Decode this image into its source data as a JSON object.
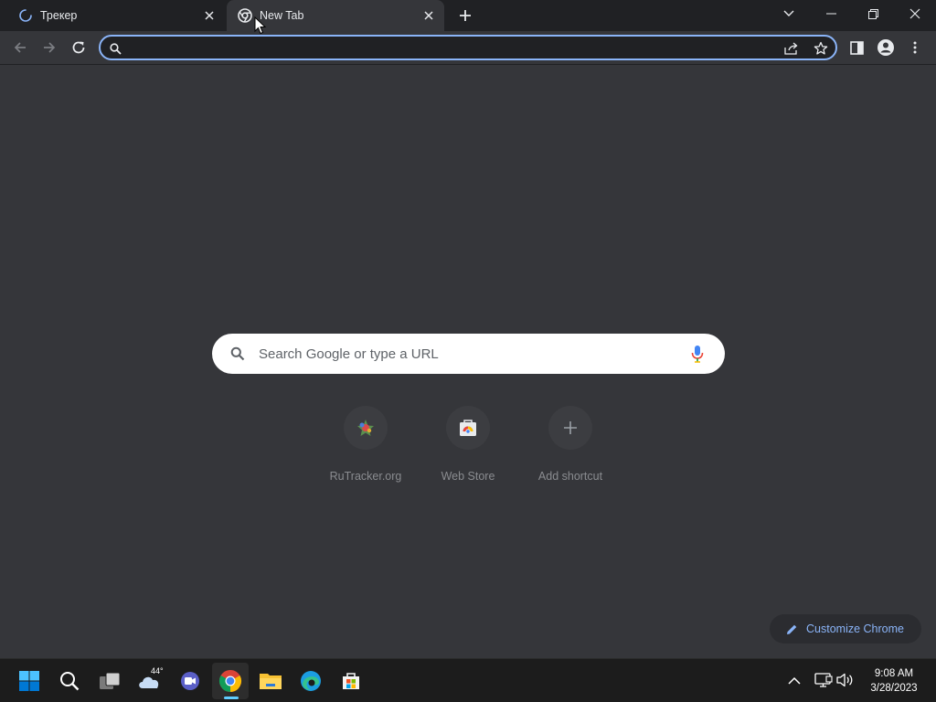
{
  "browser": {
    "tabs": [
      {
        "title": "Трекер",
        "icon": "loading-spinner-icon",
        "active": false
      },
      {
        "title": "New Tab",
        "icon": "chrome-icon",
        "active": true
      }
    ],
    "omnibox": {
      "value": "",
      "placeholder": ""
    },
    "accent_color": "#8ab4f8",
    "background_color": "#35363a",
    "tabstrip_color": "#202124"
  },
  "newtab": {
    "search_placeholder": "Search Google or type a URL",
    "shortcuts": [
      {
        "label": "RuTracker.org",
        "icon": "rutracker-favicon-icon"
      },
      {
        "label": "Web Store",
        "icon": "web-store-icon"
      },
      {
        "label": "Add shortcut",
        "icon": "plus-icon"
      }
    ],
    "customize_label": "Customize Chrome"
  },
  "taskbar": {
    "weather_temp": "44°",
    "time": "9:08 AM",
    "date": "3/28/2023",
    "apps": [
      "windows-start-icon",
      "search-icon",
      "task-view-icon",
      "weather-icon",
      "teams-chat-icon",
      "chrome-icon",
      "file-explorer-icon",
      "edge-icon",
      "microsoft-store-icon"
    ]
  }
}
